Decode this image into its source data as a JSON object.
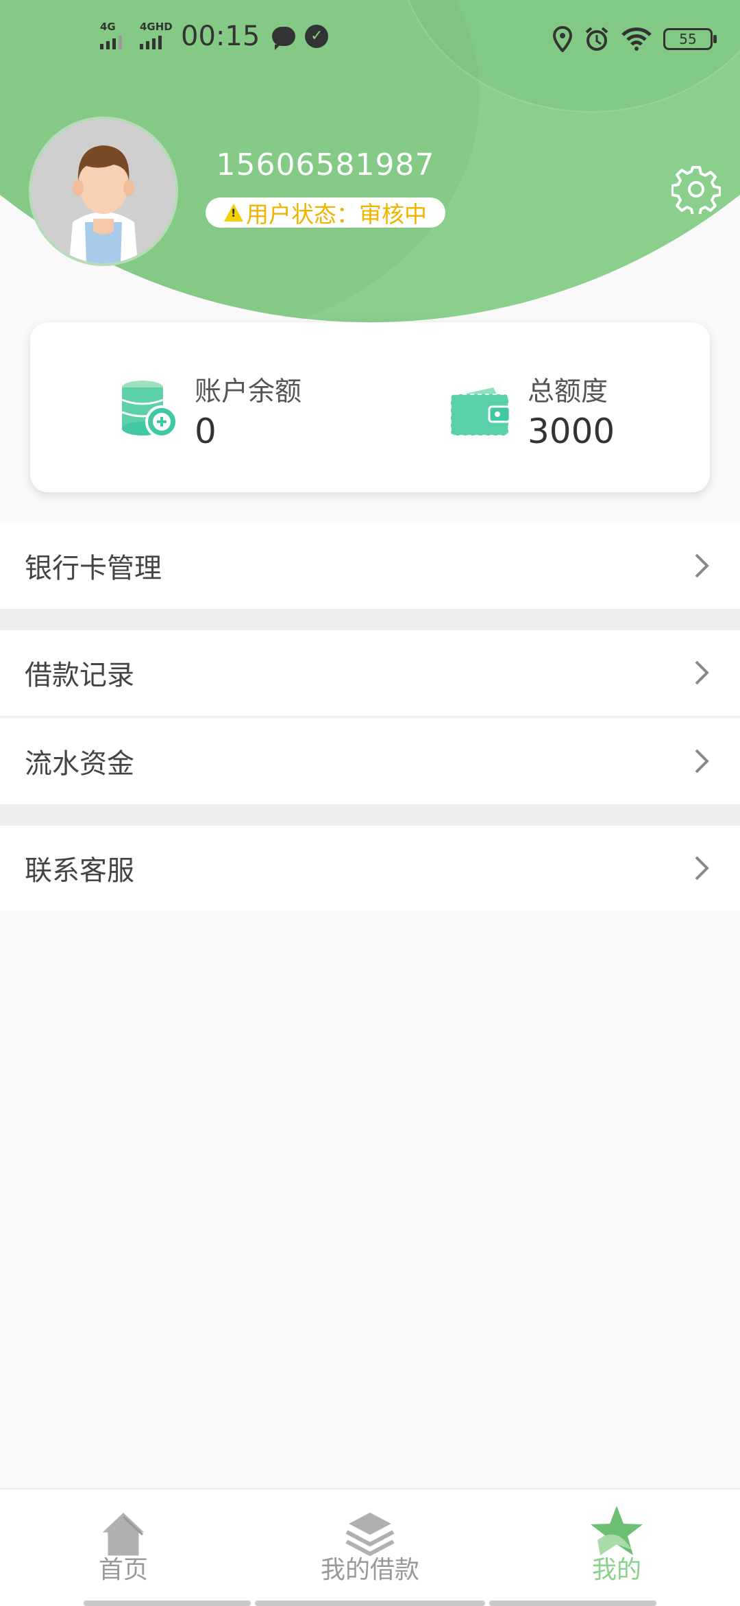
{
  "status_bar": {
    "network1": "4G",
    "network2": "4GHD",
    "time": "00:15",
    "battery": "55"
  },
  "profile": {
    "phone": "15606581987",
    "status_text": "用户状态：审核中"
  },
  "balance_card": {
    "balance_label": "账户余额",
    "balance_value": "0",
    "limit_label": "总额度",
    "limit_value": "3000"
  },
  "menu": {
    "items": [
      {
        "label": "银行卡管理"
      },
      {
        "label": "借款记录"
      },
      {
        "label": "流水资金"
      },
      {
        "label": "联系客服"
      }
    ]
  },
  "tabbar": {
    "tabs": [
      {
        "label": "首页",
        "icon": "home-icon"
      },
      {
        "label": "我的借款",
        "icon": "layers-icon"
      },
      {
        "label": "我的",
        "icon": "star-icon",
        "active": true
      }
    ]
  },
  "colors": {
    "brand_green": "#8acf8c",
    "teal": "#3fc8a3",
    "warning_yellow": "#f0b400"
  }
}
